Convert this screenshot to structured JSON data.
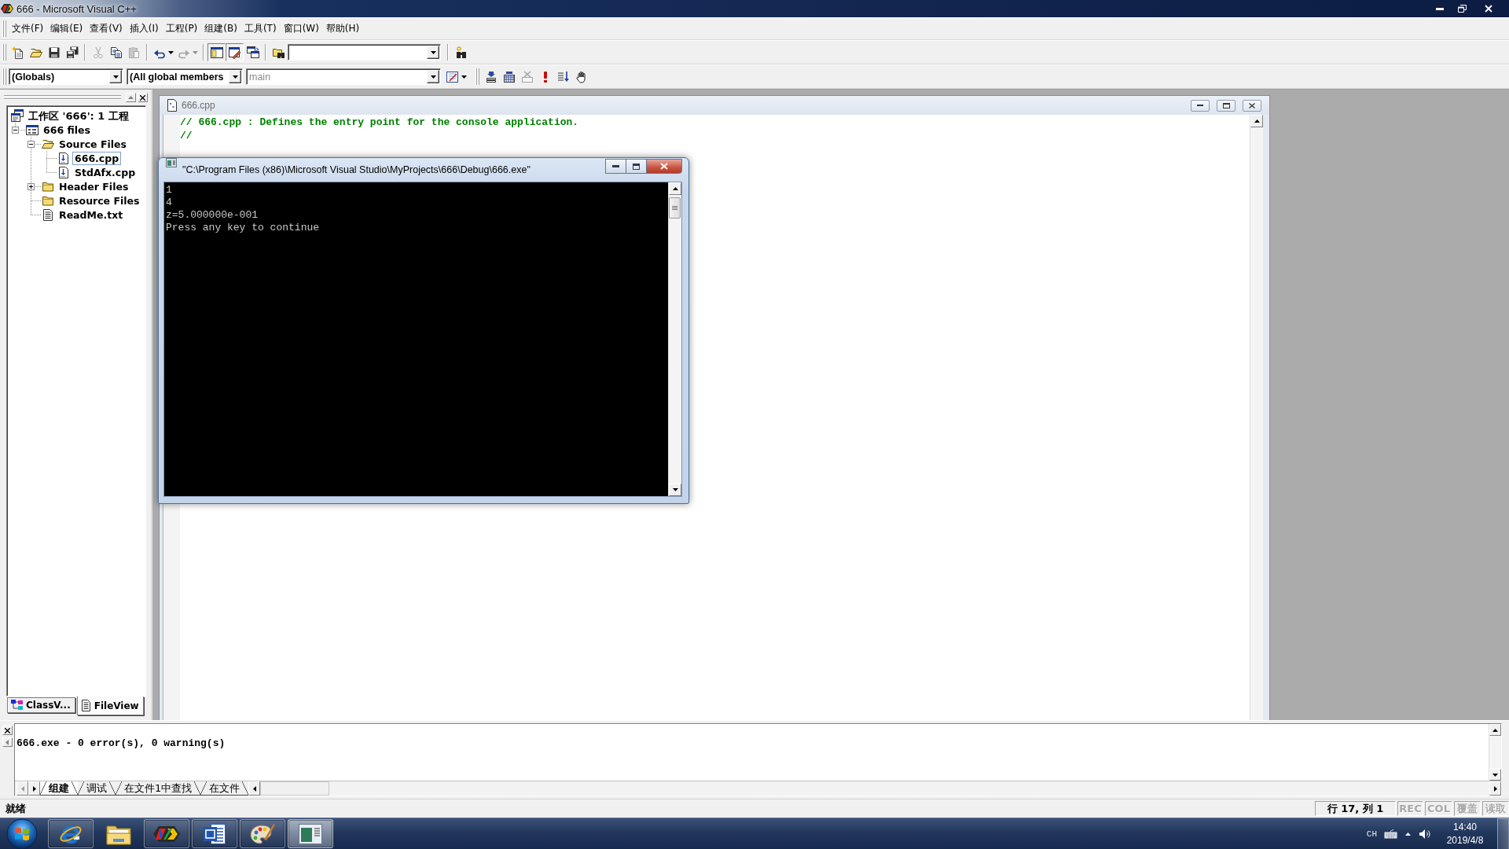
{
  "window": {
    "title": "666 - Microsoft Visual C++"
  },
  "menu": [
    {
      "label": "文件(F)"
    },
    {
      "label": "编辑(E)"
    },
    {
      "label": "查看(V)"
    },
    {
      "label": "插入(I)"
    },
    {
      "label": "工程(P)"
    },
    {
      "label": "组建(B)"
    },
    {
      "label": "工具(T)"
    },
    {
      "label": "窗口(W)"
    },
    {
      "label": "帮助(H)"
    }
  ],
  "toolbar_rows": [
    {
      "bars": [
        {
          "groups": [
            [
              {
                "kind": "new",
                "disabled": false,
                "pressed": false
              },
              {
                "kind": "open",
                "disabled": false,
                "pressed": false
              },
              {
                "kind": "save",
                "disabled": false,
                "pressed": false
              },
              {
                "kind": "save_all",
                "disabled": false,
                "pressed": false
              }
            ],
            [
              {
                "kind": "cut",
                "disabled": true,
                "pressed": false
              },
              {
                "kind": "copy",
                "disabled": false,
                "pressed": false
              },
              {
                "kind": "paste",
                "disabled": true,
                "pressed": false
              }
            ],
            [
              {
                "kind": "undo",
                "disabled": false,
                "pressed": false
              },
              {
                "kind": "redo",
                "disabled": true,
                "pressed": false
              }
            ],
            [
              {
                "kind": "workspace",
                "disabled": false,
                "pressed": true
              },
              {
                "kind": "output",
                "disabled": false,
                "pressed": true
              },
              {
                "kind": "windows",
                "disabled": false,
                "pressed": false
              }
            ],
            [
              {
                "kind": "find_in_files",
                "disabled": false,
                "pressed": false
              },
              {
                "kind": "combo"
              }
            ],
            [
              {
                "kind": "find",
                "disabled": false,
                "pressed": false
              }
            ]
          ]
        }
      ]
    },
    {
      "bars": [
        {
          "groups": [
            [
              {
                "kind": "combo",
                "value": "(Globals)",
                "disabled": false
              },
              {
                "kind": "combo",
                "value": "(All global members",
                "disabled": false
              },
              {
                "kind": "combo",
                "value": "main",
                "disabled": true
              },
              {
                "kind": "wizard",
                "disabled": false,
                "pressed": false
              }
            ]
          ]
        },
        {
          "groups": [
            [
              {
                "kind": "compile",
                "disabled": false,
                "pressed": false
              },
              {
                "kind": "build",
                "disabled": false,
                "pressed": false
              },
              {
                "kind": "stop",
                "disabled": true,
                "pressed": false
              },
              {
                "kind": "execute",
                "disabled": false,
                "pressed": false
              },
              {
                "kind": "go",
                "disabled": false,
                "pressed": false
              },
              {
                "kind": "breakpoint",
                "disabled": false,
                "pressed": false
              }
            ]
          ]
        }
      ]
    }
  ],
  "workspace": {
    "tree": [
      {
        "label": "工作区 '666': 1 工程",
        "kind": "workspace",
        "selected": false,
        "children": [
          {
            "label": "666 files",
            "kind": "project",
            "expanded": true,
            "selected": false,
            "children": [
              {
                "label": "Source Files",
                "kind": "folder",
                "expanded": true,
                "selected": false,
                "children": [
                  {
                    "label": "666.cpp",
                    "kind": "source",
                    "selected": true
                  },
                  {
                    "label": "StdAfx.cpp",
                    "kind": "source",
                    "selected": false
                  }
                ]
              },
              {
                "label": "Header Files",
                "kind": "folder",
                "expanded": false,
                "selected": false
              },
              {
                "label": "Resource Files",
                "kind": "folder",
                "selected": false
              },
              {
                "label": "ReadMe.txt",
                "kind": "text",
                "selected": false
              }
            ]
          }
        ]
      }
    ],
    "tabs": [
      {
        "label": "ClassV...",
        "kind": "classes",
        "selected": false
      },
      {
        "label": "FileView",
        "kind": "files",
        "selected": true
      }
    ]
  },
  "editor": {
    "title": "666.cpp",
    "lines": [
      {
        "kind": "comment",
        "text": "// 666.cpp : Defines the entry point for the console application."
      },
      {
        "kind": "comment",
        "text": "//"
      }
    ]
  },
  "console": {
    "title": "\"C:\\Program Files (x86)\\Microsoft Visual Studio\\MyProjects\\666\\Debug\\666.exe\"",
    "lines": [
      "1",
      "4",
      "z=5.000000e-001",
      "Press any key to continue"
    ]
  },
  "output": {
    "lines": [
      "666.exe - 0 error(s), 0 warning(s)"
    ],
    "tabs": [
      {
        "label": "组建",
        "selected": true
      },
      {
        "label": "调试",
        "selected": false
      },
      {
        "label": "在文件1中查找",
        "selected": false
      },
      {
        "label": "在文件",
        "selected": false
      }
    ]
  },
  "status_bar": {
    "message": "就绪",
    "panes": [
      {
        "text": "行 17, 列 1",
        "disabled": false
      },
      {
        "text": "REC",
        "disabled": true
      },
      {
        "text": "COL",
        "disabled": true
      },
      {
        "text": "覆盖",
        "disabled": true
      },
      {
        "text": "读取",
        "disabled": true
      }
    ]
  },
  "taskbar": {
    "apps": [
      {
        "kind": "browser",
        "running": true,
        "selected": false
      },
      {
        "kind": "folder",
        "running": false,
        "selected": false
      },
      {
        "kind": "ide",
        "running": true,
        "selected": false
      },
      {
        "kind": "word",
        "running": true,
        "selected": false
      },
      {
        "kind": "paint",
        "running": true,
        "selected": false
      },
      {
        "kind": "console",
        "running": true,
        "selected": true
      }
    ],
    "tray": {
      "language": "CH",
      "time": "14:40",
      "date": "2019/4/8"
    }
  }
}
